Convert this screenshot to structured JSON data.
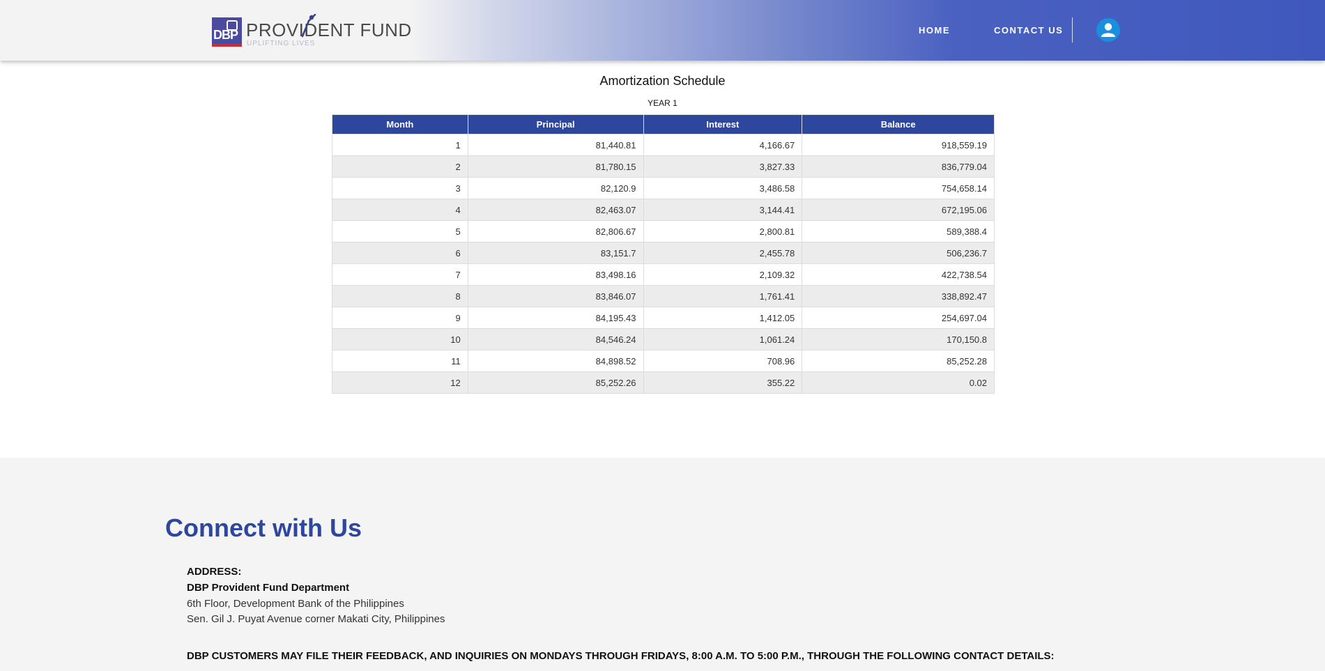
{
  "header": {
    "logo_mark": "DBP",
    "brand_name": "PROVIDENT FUND",
    "tagline": "UPLIFTING LIVES",
    "nav": {
      "home": "HOME",
      "contact": "CONTACT US"
    },
    "user_icon": "user-icon",
    "colors": {
      "accent": "#2e479e",
      "header_end": "#3f58bd",
      "avatar": "#1a8fe0"
    }
  },
  "schedule": {
    "title": "Amortization Schedule",
    "year_label": "YEAR 1",
    "columns": [
      "Month",
      "Principal",
      "Interest",
      "Balance"
    ],
    "rows": [
      [
        "1",
        "81,440.81",
        "4,166.67",
        "918,559.19"
      ],
      [
        "2",
        "81,780.15",
        "3,827.33",
        "836,779.04"
      ],
      [
        "3",
        "82,120.9",
        "3,486.58",
        "754,658.14"
      ],
      [
        "4",
        "82,463.07",
        "3,144.41",
        "672,195.06"
      ],
      [
        "5",
        "82,806.67",
        "2,800.81",
        "589,388.4"
      ],
      [
        "6",
        "83,151.7",
        "2,455.78",
        "506,236.7"
      ],
      [
        "7",
        "83,498.16",
        "2,109.32",
        "422,738.54"
      ],
      [
        "8",
        "83,846.07",
        "1,761.41",
        "338,892.47"
      ],
      [
        "9",
        "84,195.43",
        "1,412.05",
        "254,697.04"
      ],
      [
        "10",
        "84,546.24",
        "1,061.24",
        "170,150.8"
      ],
      [
        "11",
        "84,898.52",
        "708.96",
        "85,252.28"
      ],
      [
        "12",
        "85,252.26",
        "355.22",
        "0.02"
      ]
    ]
  },
  "footer": {
    "heading": "Connect with Us",
    "address_label": "ADDRESS:",
    "department": "DBP Provident Fund Department",
    "address_line1": "6th Floor, Development Bank of the Philippines",
    "address_line2": "Sen. Gil J. Puyat Avenue corner Makati City, Philippines",
    "feedback_note": "DBP CUSTOMERS MAY FILE THEIR FEEDBACK, AND INQUIRIES ON MONDAYS THROUGH FRIDAYS, 8:00 A.M. TO 5:00 P.M., THROUGH THE FOLLOWING CONTACT DETAILS:"
  }
}
